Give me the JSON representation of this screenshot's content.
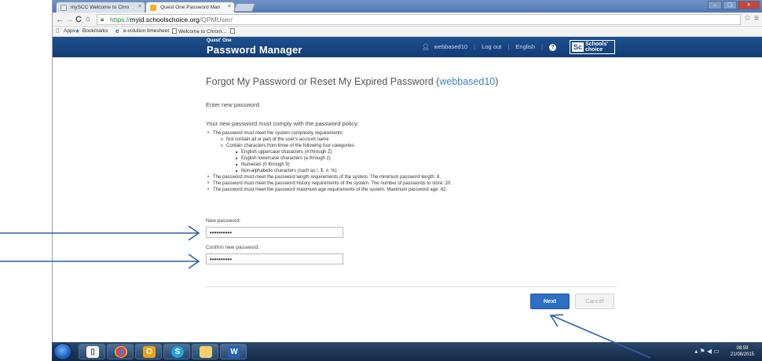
{
  "browser": {
    "tabs": [
      {
        "label": "mySCC Welcome to Chro",
        "active": false
      },
      {
        "label": "Quest One Password Man",
        "active": true
      }
    ],
    "url": {
      "scheme": "https://",
      "host": "myid.schoolschoice.org",
      "path": "/QPMUser/"
    },
    "bookmarks": [
      {
        "label": "Apps",
        "icon": "apps-grid-icon"
      },
      {
        "label": "Bookmarks",
        "icon": "star-icon"
      },
      {
        "label": "e-volution timesheet",
        "icon": "ie-e-icon"
      },
      {
        "label": "Welcome to Chrom...",
        "icon": "page-icon"
      }
    ]
  },
  "header": {
    "brand_small": "Quest' One",
    "brand": "Password Manager",
    "username": "webbased10",
    "logout": "Log out",
    "language": "English",
    "logo_mono": "Sc",
    "logo_text": "Schools' choice"
  },
  "main": {
    "title_prefix": "Forgot My Password or Reset My Expired Password (",
    "title_account": "webbased10",
    "title_suffix": ")",
    "enter_text": "Enter new password.",
    "policy_intro": "Your new password must comply with the password policy:",
    "policy": {
      "complexity": "The password must meet the system complexity requirements:",
      "no_account_name": "Not contain all or part of the user's account name",
      "categories": "Contain characters from three of the following four categories:",
      "category_items": [
        "English uppercase characters (A through Z)",
        "English lowercase characters (a through z)",
        "Numerals (0 through 9)",
        "Non-alphabetic characters (such as !, $, #, %)"
      ],
      "length": "The password must meet the password length requirements of the system. The minimum password length: 8.",
      "history": "The password must meet the password history requirements of the system. The number of passwords to store: 20.",
      "max_age": "The password must meet the password maximum age requirements of the system. Maximum password age: 42."
    },
    "new_password_label": "New password:",
    "new_password_value": "••••••••••",
    "confirm_password_label": "Confirm new password:",
    "confirm_password_value": "••••••••••",
    "next_label": "Next",
    "cancel_label": "Cancel"
  },
  "taskbar": {
    "time": "08:59",
    "date": "21/08/2015",
    "apps": [
      "start-orb",
      "file-explorer-icon",
      "chrome-icon",
      "outlook-icon",
      "skype-icon",
      "folder-icon",
      "word-icon"
    ]
  },
  "colors": {
    "header_blue": "#1d4f8f",
    "link_blue": "#3b82c4",
    "next_button": "#2c6fc3",
    "arrow": "#2e5fa8"
  }
}
